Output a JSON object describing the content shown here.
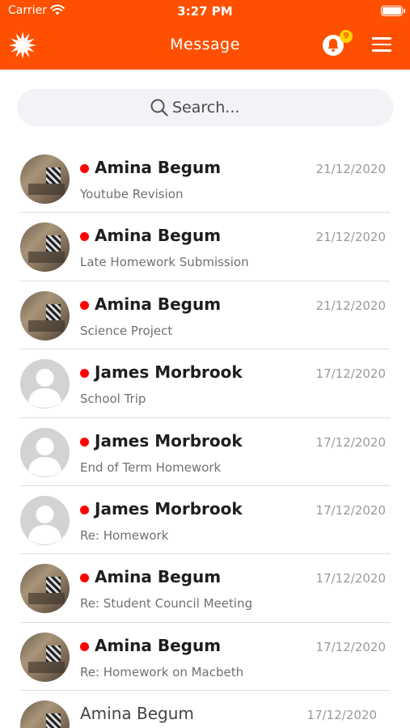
{
  "status_bar": {
    "carrier": "Carrier",
    "time": "3:27 PM"
  },
  "header": {
    "title": "Message",
    "notification_count": "9",
    "accent": "#fe5000",
    "badge_color": "#ffd400"
  },
  "search": {
    "placeholder": "Search..."
  },
  "messages": [
    {
      "name": "Amina Begum",
      "subject": "Youtube Revision",
      "date": "21/12/2020",
      "unread": true,
      "avatar": "photo"
    },
    {
      "name": "Amina Begum",
      "subject": "Late Homework Submission",
      "date": "21/12/2020",
      "unread": true,
      "avatar": "photo"
    },
    {
      "name": "Amina Begum",
      "subject": "Science Project",
      "date": "21/12/2020",
      "unread": true,
      "avatar": "photo"
    },
    {
      "name": "James Morbrook",
      "subject": "School Trip",
      "date": "17/12/2020",
      "unread": true,
      "avatar": "placeholder"
    },
    {
      "name": "James Morbrook",
      "subject": "End of Term Homework",
      "date": "17/12/2020",
      "unread": true,
      "avatar": "placeholder"
    },
    {
      "name": "James Morbrook",
      "subject": "Re: Homework",
      "date": "17/12/2020",
      "unread": true,
      "avatar": "placeholder"
    },
    {
      "name": "Amina Begum",
      "subject": "Re: Student Council Meeting",
      "date": "17/12/2020",
      "unread": true,
      "avatar": "photo"
    },
    {
      "name": "Amina Begum",
      "subject": "Re: Homework on Macbeth",
      "date": "17/12/2020",
      "unread": true,
      "avatar": "photo"
    },
    {
      "name": "Amina Begum",
      "subject": "",
      "date": "17/12/2020",
      "unread": false,
      "avatar": "photo"
    }
  ]
}
